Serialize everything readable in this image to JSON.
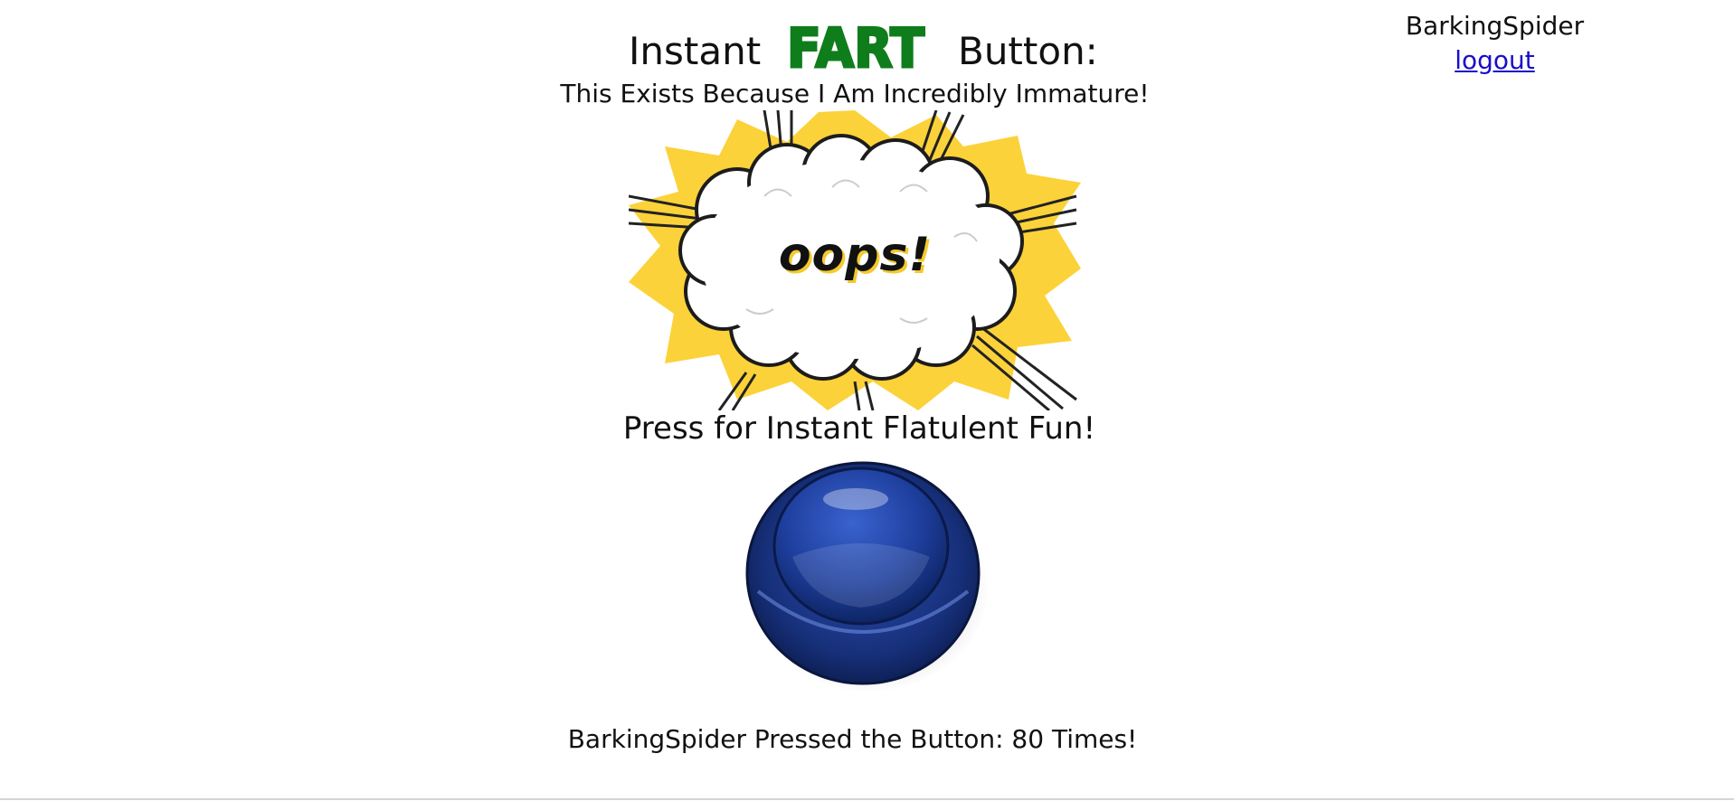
{
  "header": {
    "title_prefix": "Instant",
    "logo_word": "FART",
    "title_suffix": "Button:",
    "subtitle": "This Exists Because I Am Incredibly Immature!"
  },
  "user": {
    "name": "BarkingSpider",
    "logout_label": "logout"
  },
  "hero": {
    "exclamation": "oops!"
  },
  "main": {
    "press_label": "Press for Instant Flatulent Fun!",
    "counter_text": "BarkingSpider Pressed the Button: 80 Times!"
  },
  "colors": {
    "logo_green": "#0f7d1b",
    "button_blue": "#1f3f9a",
    "burst_yellow": "#fcd23a",
    "link_blue": "#1a0dcc"
  },
  "icons": {
    "logo": "fart-wordmark",
    "hero_image": "comic-burst-cloud",
    "action_button": "blue-push-button"
  }
}
